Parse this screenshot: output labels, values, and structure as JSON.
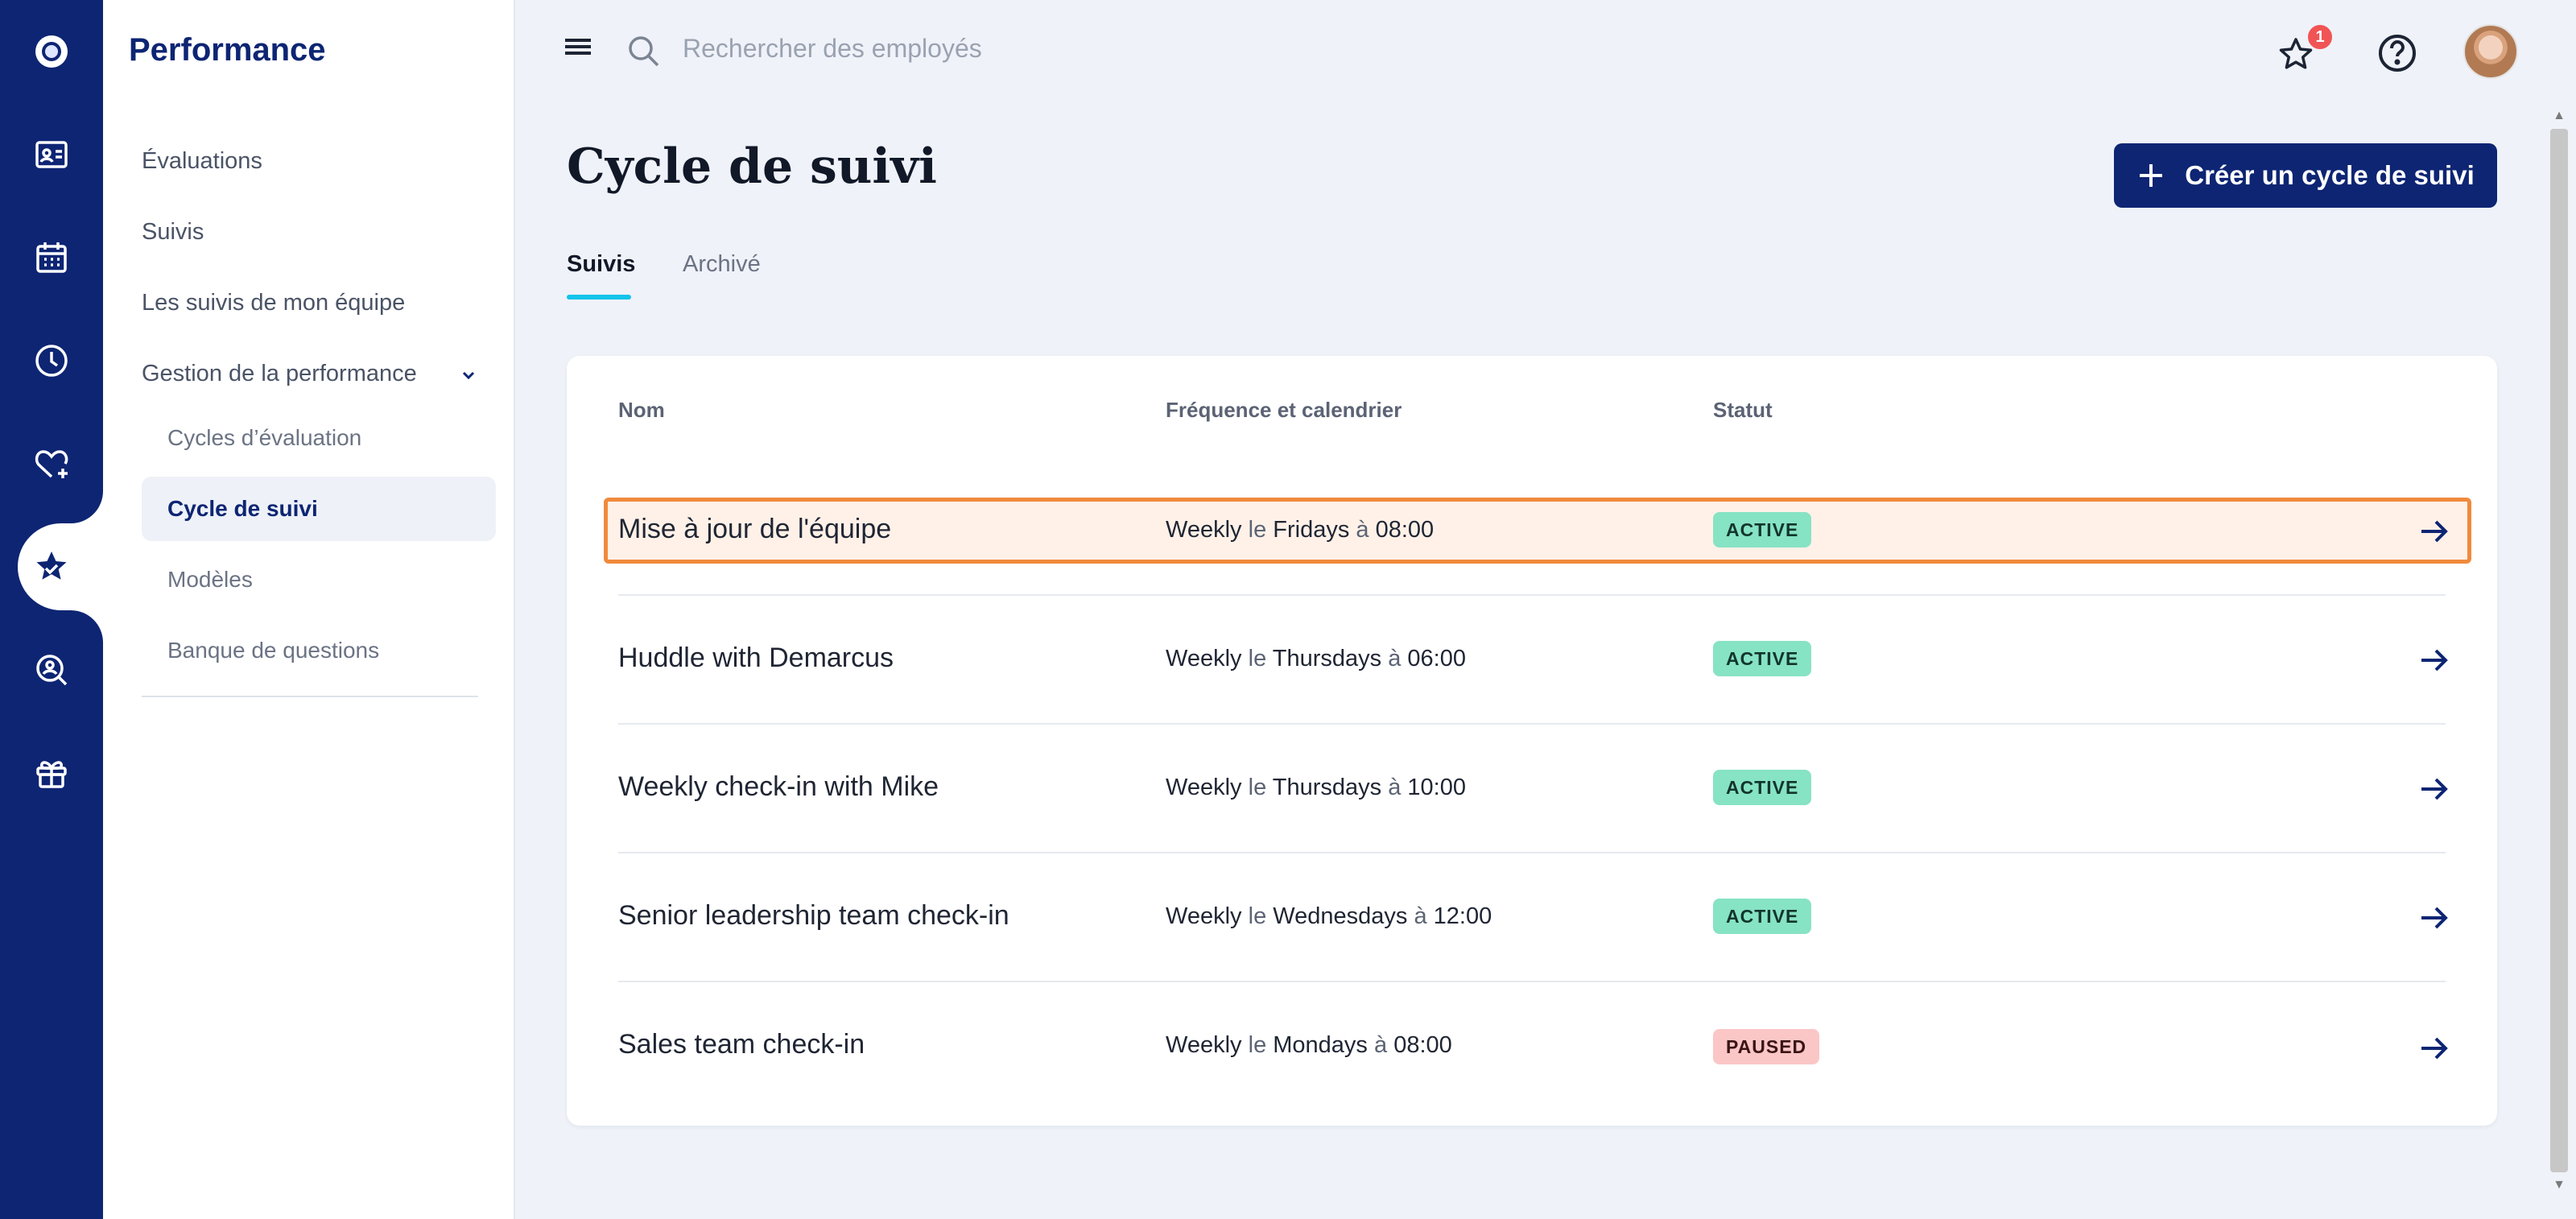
{
  "colors": {
    "brand": "#0d2573",
    "accent_underline": "#12c3ea",
    "active_status": "#86e3c4",
    "paused_status": "#fbc6c6",
    "highlight_border": "#f08a3c"
  },
  "rail": {
    "icons": [
      "logo-icon",
      "contact-card-icon",
      "calendar-icon",
      "clock-icon",
      "heart-plus-icon",
      "star-performance-icon",
      "search-person-icon",
      "gift-icon"
    ],
    "active": "star-performance-icon"
  },
  "sidebar": {
    "title": "Performance",
    "items": [
      {
        "label": "Évaluations"
      },
      {
        "label": "Suivis"
      },
      {
        "label": "Les suivis de mon équipe"
      },
      {
        "label": "Gestion de la performance"
      }
    ],
    "sub_items": [
      {
        "label": "Cycles d’évaluation"
      },
      {
        "label": "Cycle de suivi",
        "selected": true
      },
      {
        "label": "Modèles"
      },
      {
        "label": "Banque de questions"
      }
    ]
  },
  "topbar": {
    "search_placeholder": "Rechercher des employés",
    "notification_count": "1"
  },
  "page": {
    "title": "Cycle de suivi",
    "create_button": "Créer un cycle de suivi",
    "tabs": [
      {
        "label": "Suivis",
        "active": true
      },
      {
        "label": "Archivé",
        "active": false
      }
    ]
  },
  "table": {
    "headers": {
      "name": "Nom",
      "frequency": "Fréquence et calendrier",
      "status": "Statut"
    },
    "rows": [
      {
        "name": "Mise à jour de l'équipe",
        "freq": "Weekly",
        "le": "le",
        "day": "Fridays",
        "a": "à",
        "time": "08:00",
        "status": "ACTIVE"
      },
      {
        "name": "Huddle with Demarcus",
        "freq": "Weekly",
        "le": "le",
        "day": "Thursdays",
        "a": "à",
        "time": "06:00",
        "status": "ACTIVE"
      },
      {
        "name": "Weekly check-in with Mike",
        "freq": "Weekly",
        "le": "le",
        "day": "Thursdays",
        "a": "à",
        "time": "10:00",
        "status": "ACTIVE"
      },
      {
        "name": "Senior leadership team check-in",
        "freq": "Weekly",
        "le": "le",
        "day": "Wednesdays",
        "a": "à",
        "time": "12:00",
        "status": "ACTIVE"
      },
      {
        "name": "Sales team check-in",
        "freq": "Weekly",
        "le": "le",
        "day": "Mondays",
        "a": "à",
        "time": "08:00",
        "status": "PAUSED"
      }
    ]
  }
}
